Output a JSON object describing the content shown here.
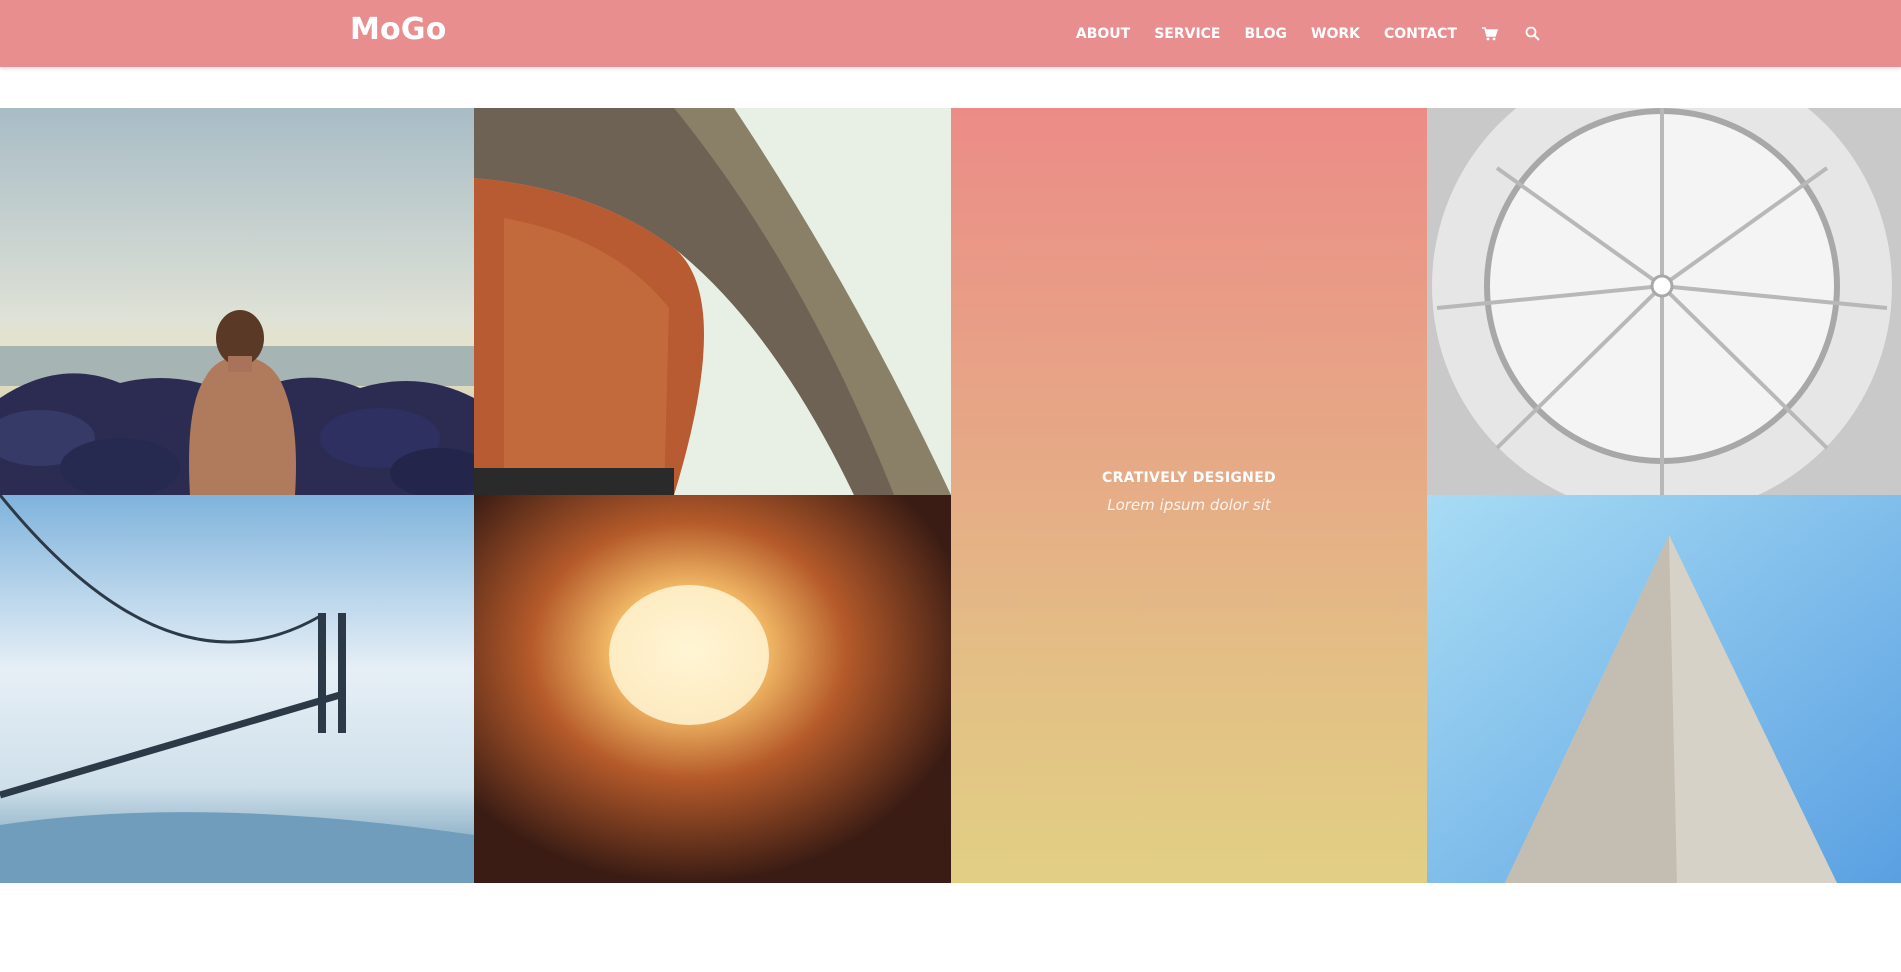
{
  "header": {
    "logo": "MoGo",
    "nav": [
      "ABOUT",
      "SERVICE",
      "BLOG",
      "WORK",
      "CONTACT"
    ],
    "icons": [
      "cart-icon",
      "search-icon"
    ],
    "background_color": "#e98e8f"
  },
  "gallery": {
    "feature": {
      "title": "CRATIVELY DESIGNED",
      "subtitle": "Lorem ipsum dolor sit"
    }
  }
}
